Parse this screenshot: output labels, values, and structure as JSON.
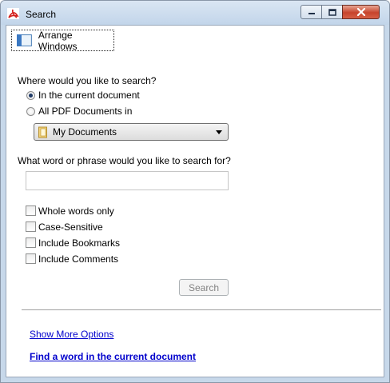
{
  "window": {
    "title": "Search",
    "controls": [
      "minimize-icon",
      "maximize-icon",
      "close-icon"
    ]
  },
  "toolbar": {
    "arrange_label": "Arrange Windows"
  },
  "search": {
    "where_label": "Where would you like to search?",
    "options": [
      {
        "label": "In the current document",
        "selected": true
      },
      {
        "label": "All PDF Documents in",
        "selected": false
      }
    ],
    "location_value": "My Documents",
    "query_label": "What word or phrase would you like to search for?",
    "query_value": "",
    "checkboxes": [
      {
        "label": "Whole words only",
        "checked": false
      },
      {
        "label": "Case-Sensitive",
        "checked": false
      },
      {
        "label": "Include Bookmarks",
        "checked": false
      },
      {
        "label": "Include Comments",
        "checked": false
      }
    ],
    "search_button": "Search"
  },
  "links": {
    "more_options": "Show More Options",
    "find_word": "Find a word in the current document"
  },
  "colors": {
    "titlebar": "#c7d8ea",
    "close_button": "#c7442c",
    "link": "#0000cc",
    "pdf_red": "#d4201c"
  }
}
